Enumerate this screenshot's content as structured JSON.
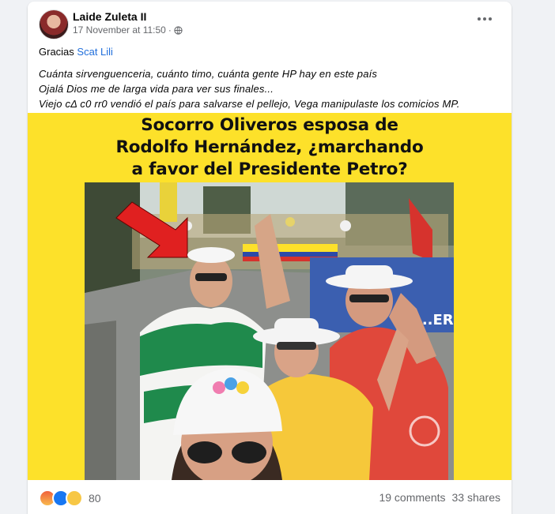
{
  "post": {
    "author": "Laide Zuleta II",
    "timestamp": "17 November at 11:50",
    "separator": "·",
    "privacy_icon": "globe-icon",
    "more_icon": "more-options-icon",
    "thanks_prefix": "Gracias",
    "thanks_link": "Scat Lili",
    "lines": [
      "Cuánta sirvenguenceria, cuánto timo, cuánta gente HP hay en este país",
      "Ojalá Dios me de larga vida para ver sus finales...",
      "Viejo cΔ c0 rr0 vendió el país para salvarse el pellejo, Vega manipulaste los comicios MP."
    ]
  },
  "image": {
    "headline_lines": [
      "Socorro Oliveros esposa de",
      "Rodolfo Hernández, ¿marchando",
      "a favor del Presidente Petro?"
    ],
    "background_color": "#fde12a",
    "banner_text": "...ER"
  },
  "footer": {
    "reaction_icons": [
      "angry-reaction-icon",
      "like-reaction-icon",
      "haha-reaction-icon"
    ],
    "reaction_count": "80",
    "comments": "19 comments",
    "shares": "33 shares"
  }
}
